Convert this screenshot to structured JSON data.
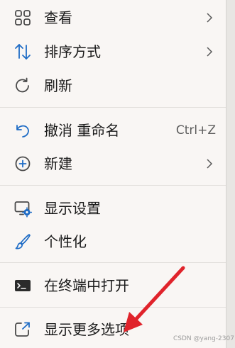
{
  "colors": {
    "menu_background": "#f9f6f4",
    "icon_blue": "#1f6cc5",
    "icon_gray": "#4a4a4a",
    "text": "#1b1b1b",
    "shortcut_text": "#5e5e5e",
    "pointer_arrow": "#e0232b"
  },
  "menu": {
    "items": [
      {
        "label": "查看",
        "icon": "grid-view-icon",
        "submenu": true
      },
      {
        "label": "排序方式",
        "icon": "sort-arrows-icon",
        "submenu": true
      },
      {
        "label": "刷新",
        "icon": "refresh-icon",
        "submenu": false
      },
      {
        "label": "撤消 重命名",
        "icon": "undo-icon",
        "shortcut": "Ctrl+Z",
        "submenu": false
      },
      {
        "label": "新建",
        "icon": "plus-circle-icon",
        "submenu": true
      },
      {
        "label": "显示设置",
        "icon": "display-settings-icon",
        "submenu": false
      },
      {
        "label": "个性化",
        "icon": "paintbrush-icon",
        "submenu": false
      },
      {
        "label": "在终端中打开",
        "icon": "terminal-icon",
        "submenu": false
      },
      {
        "label": "显示更多选项",
        "icon": "show-more-options-icon",
        "submenu": false
      }
    ]
  },
  "watermark": "CSDN @yang-2307"
}
